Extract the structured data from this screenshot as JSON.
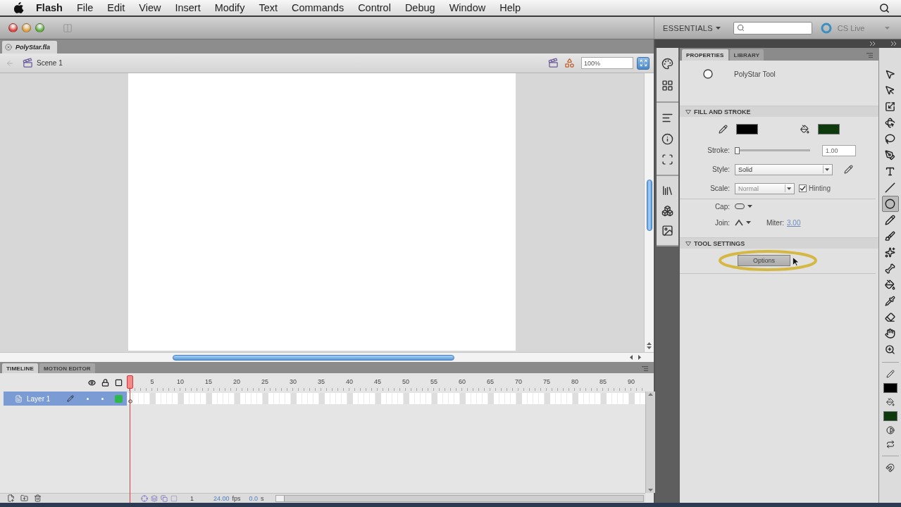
{
  "menu_bar": {
    "app_name": "Flash",
    "menus": [
      "File",
      "Edit",
      "View",
      "Insert",
      "Modify",
      "Text",
      "Commands",
      "Control",
      "Debug",
      "Window",
      "Help"
    ]
  },
  "title_bar": {
    "workspace": "ESSENTIALS",
    "cs_live": "CS Live"
  },
  "document_tabs": [
    {
      "label": "PolyStar.fla",
      "selected": true
    }
  ],
  "edit_bar": {
    "scene": "Scene 1",
    "zoom": "100%"
  },
  "timeline": {
    "tabs": [
      {
        "label": "TIMELINE",
        "selected": true
      },
      {
        "label": "MOTION EDITOR",
        "selected": false
      }
    ],
    "frame_numbers": [
      "5",
      "10",
      "15",
      "20",
      "25",
      "30",
      "35",
      "40",
      "45",
      "50",
      "55",
      "60",
      "65",
      "70",
      "75",
      "80",
      "85",
      "90"
    ],
    "layers": [
      {
        "name": "Layer 1",
        "selected": true,
        "color": "#2fb84a"
      }
    ],
    "current_frame": "1",
    "frame_rate": "24.00",
    "frame_rate_unit": "fps",
    "elapsed_time": "0.0",
    "elapsed_time_unit": "s"
  },
  "properties_panel": {
    "tabs": [
      {
        "label": "PROPERTIES",
        "selected": true
      },
      {
        "label": "LIBRARY",
        "selected": false
      }
    ],
    "tool_name": "PolyStar Tool",
    "fill_and_stroke": {
      "title": "FILL AND STROKE",
      "expanded": true,
      "swatches": [
        {
          "kind": "stroke",
          "color": "#000000"
        },
        {
          "kind": "fill",
          "color": "#0d3b0d"
        }
      ],
      "stroke": {
        "label": "Stroke:",
        "level": 0.0,
        "value": "1.00"
      },
      "style": {
        "label": "Style:",
        "value": "Solid"
      },
      "scale": {
        "label": "Scale:",
        "value": "Normal",
        "disabled": true
      },
      "hinting": {
        "label": "Hinting",
        "checked": true
      },
      "cap": {
        "label": "Cap:"
      },
      "join": {
        "label": "Join:"
      },
      "miter": {
        "label": "Miter:",
        "value": "3.00"
      }
    },
    "tool_settings": {
      "title": "TOOL SETTINGS",
      "expanded": true,
      "options_button": {
        "label": "Options",
        "highlighted": true
      }
    }
  },
  "tools": {
    "items": [
      {
        "kind": "selection",
        "selected": false
      },
      {
        "kind": "subselection",
        "selected": false
      },
      {
        "kind": "transform",
        "selected": false
      },
      {
        "kind": "rotate",
        "selected": false
      },
      {
        "kind": "lasso",
        "selected": false
      },
      {
        "kind": "pen",
        "selected": false
      },
      {
        "kind": "text",
        "selected": false
      },
      {
        "kind": "line",
        "selected": false
      },
      {
        "kind": "oval",
        "selected": true
      },
      {
        "kind": "pencil",
        "selected": false
      },
      {
        "kind": "brush",
        "selected": false
      },
      {
        "kind": "deco",
        "selected": false
      },
      {
        "kind": "bone",
        "selected": false
      },
      {
        "kind": "bucket",
        "selected": false
      },
      {
        "kind": "eyedropper",
        "selected": false
      },
      {
        "kind": "eraser",
        "selected": false
      },
      {
        "kind": "hand",
        "selected": false
      },
      {
        "kind": "zoom",
        "selected": false
      }
    ],
    "swatches": [
      {
        "kind": "stroke",
        "color": "#000000"
      },
      {
        "kind": "fill",
        "color": "#0d3b0d"
      }
    ]
  }
}
